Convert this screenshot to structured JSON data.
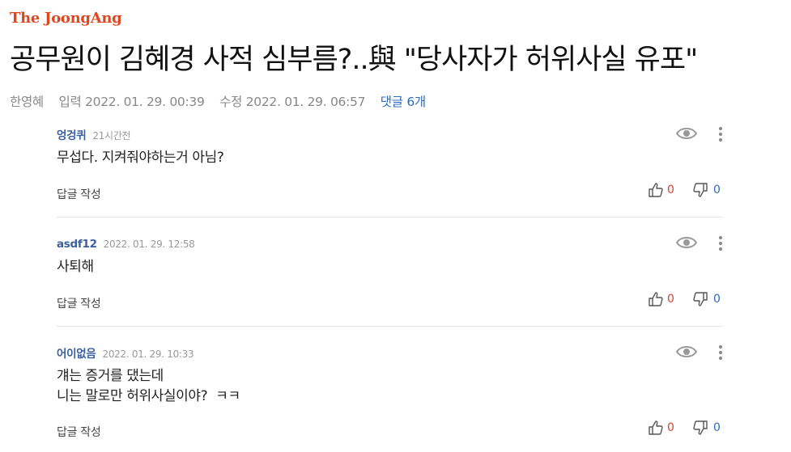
{
  "brand": {
    "logo": "The JoongAng"
  },
  "article": {
    "headline": "공무원이 김혜경 사적 심부름?..與 \"당사자가 허위사실 유포\"",
    "author": "한영혜",
    "published": "입력 2022. 01. 29. 00:39",
    "updated": "수정 2022. 01. 29. 06:57",
    "comment_count": "댓글 6개"
  },
  "comments": [
    {
      "user": "엉겅퀴",
      "time": "21시간전",
      "lines": [
        "무섭다. 지켜줘야하는거 아님?"
      ],
      "reply_label": "답글 작성",
      "likes": "0",
      "dislikes": "0"
    },
    {
      "user": "asdf12",
      "time": "2022. 01. 29. 12:58",
      "lines": [
        "사퇴해"
      ],
      "reply_label": "답글 작성",
      "likes": "0",
      "dislikes": "0"
    },
    {
      "user": "어이없음",
      "time": "2022. 01. 29. 10:33",
      "lines": [
        "걔는 증거를 댔는데",
        "니는 말로만 허위사실이야?  ㅋㅋ"
      ],
      "reply_label": "답글 작성",
      "likes": "0",
      "dislikes": "0"
    }
  ],
  "colors": {
    "brand": "#e0461f",
    "link": "#2d6bbf",
    "like": "#d0443a",
    "dislike": "#2d6bbf"
  },
  "icons": {
    "view": "eye-icon",
    "menu": "more-vertical-icon",
    "like": "thumbs-up-icon",
    "dislike": "thumbs-down-icon"
  }
}
